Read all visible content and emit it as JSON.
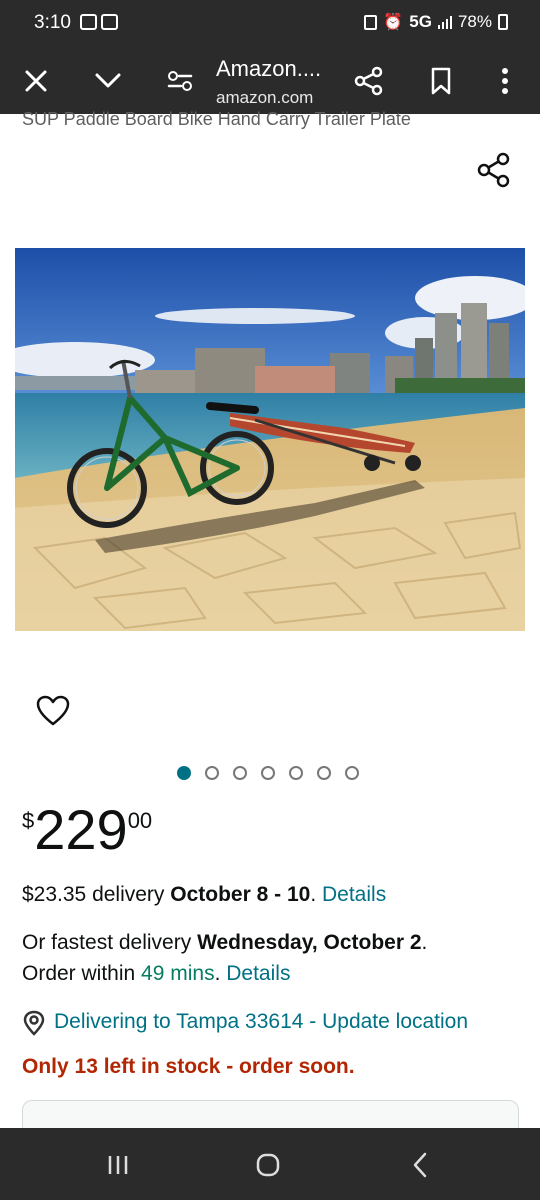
{
  "status": {
    "time": "3:10",
    "network": "5G",
    "battery": "78%"
  },
  "toolbar": {
    "title": "Amazon....",
    "domain": "amazon.com"
  },
  "product": {
    "title_partial": "SUP Paddle Board Bike Hand Carry Trailer Plate",
    "image_count": 7,
    "active_image": 1
  },
  "price": {
    "symbol": "$",
    "whole": "229",
    "fraction": "00"
  },
  "delivery": {
    "cost": "$23.35 delivery ",
    "dates": "October 8 - 10",
    "period": ". ",
    "details_label": "Details"
  },
  "fastest": {
    "prefix": "Or fastest delivery ",
    "date": "Wednesday, October 2",
    "period": ".",
    "order_within": "Order within ",
    "countdown": "49 mins",
    "period2": ". ",
    "details_label": "Details"
  },
  "location": {
    "text": "Delivering to Tampa 33614 - Update location"
  },
  "stock": {
    "text": "Only 13 left in stock - order soon."
  },
  "colors": {
    "link": "#007185",
    "price_alert": "#b12704",
    "countdown": "#067d62",
    "chrome": "#2b2b2b"
  }
}
